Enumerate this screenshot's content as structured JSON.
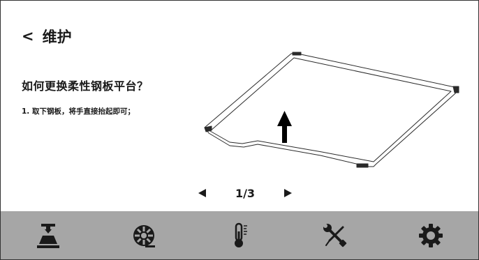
{
  "header": {
    "back_icon": "<",
    "title": "维护"
  },
  "content": {
    "question": "如何更换柔性钢板平台？",
    "step_text": "1. 取下钢板，将手直接抬起即可；",
    "illustration": "flexible-steel-plate-lift-up"
  },
  "pager": {
    "current": 1,
    "total": 3,
    "text": "1/3",
    "prev_icon": "left-triangle",
    "next_icon": "right-triangle"
  },
  "toolbar": {
    "items": [
      {
        "icon": "print-nozzle-icon"
      },
      {
        "icon": "filament-spool-icon"
      },
      {
        "icon": "thermometer-icon"
      },
      {
        "icon": "tools-icon"
      },
      {
        "icon": "settings-gear-icon"
      }
    ]
  },
  "colors": {
    "toolbar_bg": "#a6a6a6",
    "icon": "#1a1a1a",
    "text": "#1a1a1a"
  }
}
